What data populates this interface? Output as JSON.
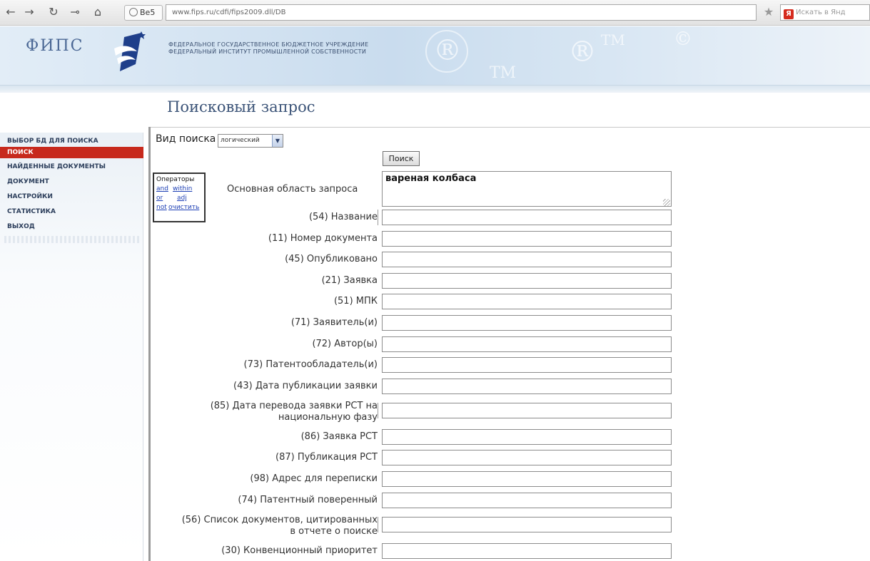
{
  "browser": {
    "tab_label": "Ве5",
    "url": "www.fips.ru/cdfi/fips2009.dll/DB",
    "yandex_placeholder": "Искать в Янд"
  },
  "header": {
    "logo_text": "ФИПС",
    "org_line1": "ФЕДЕРАЛЬНОЕ ГОСУДАРСТВЕННОЕ БЮДЖЕТНОЕ УЧРЕЖДЕНИЕ",
    "org_line2": "ФЕДЕРАЛЬНЫЙ ИНСТИТУТ ПРОМЫШЛЕННОЙ СОБСТВЕННОСТИ",
    "watermark_r": "®",
    "watermark_tm": "TM",
    "watermark_c": "©"
  },
  "page_title": "Поисковый запрос",
  "sidebar": {
    "items": [
      {
        "label": "ВЫБОР БД ДЛЯ ПОИСКА",
        "active": false
      },
      {
        "label": "ПОИСК",
        "active": true
      },
      {
        "label": "НАЙДЕННЫЕ ДОКУМЕНТЫ",
        "active": false
      },
      {
        "label": "ДОКУМЕНТ",
        "active": false
      },
      {
        "label": "НАСТРОЙКИ",
        "active": false
      },
      {
        "label": "СТАТИСТИКА",
        "active": false
      },
      {
        "label": "ВЫХОД",
        "active": false
      }
    ]
  },
  "search": {
    "type_label": "Вид поиска",
    "type_value": "логический",
    "button_label": "Поиск",
    "operators": {
      "title": "Операторы",
      "and": "and",
      "within": "within",
      "or": "or",
      "adj": "adj",
      "not": "not",
      "clear": "очистить"
    },
    "main_label": "Основная область запроса",
    "main_value": "вареная колбаса",
    "fields": [
      {
        "label": "(54) Название"
      },
      {
        "label": "(11) Номер документа"
      },
      {
        "label": "(45) Опубликовано"
      },
      {
        "label": "(21) Заявка"
      },
      {
        "label": "(51) МПК"
      },
      {
        "label": "(71) Заявитель(и)"
      },
      {
        "label": "(72) Автор(ы)"
      },
      {
        "label": "(73) Патентообладатель(и)"
      },
      {
        "label": "(43) Дата публикации заявки"
      },
      {
        "label_line1": "(85) Дата перевода заявки PCT на",
        "label_line2": "национальную фазу"
      },
      {
        "label": "(86) Заявка PCT"
      },
      {
        "label": "(87) Публикация PCT"
      },
      {
        "label": "(98) Адрес для переписки"
      },
      {
        "label": "(74) Патентный поверенный"
      },
      {
        "label_line1": "(56) Список документов, цитированных",
        "label_line2": "в отчете о поиске"
      },
      {
        "label": "(30) Конвенционный приоритет"
      }
    ]
  }
}
